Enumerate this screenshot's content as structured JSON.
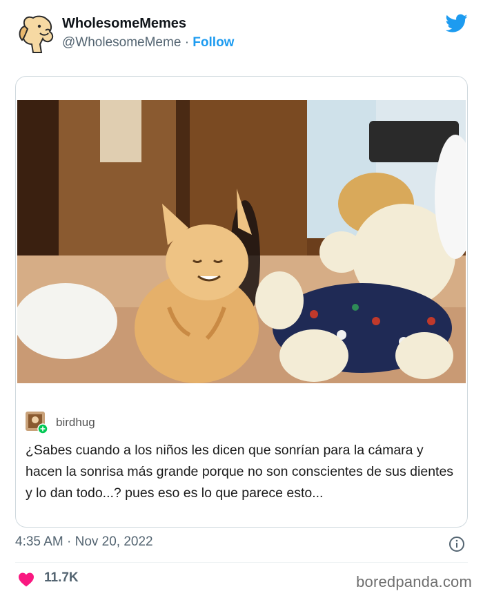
{
  "account": {
    "name": "WholesomeMemes",
    "handle": "@WholesomeMeme",
    "separator": "·",
    "follow_label": "Follow"
  },
  "embedded_post": {
    "author": "birdhug",
    "text": "¿Sabes cuando a los niños les dicen que sonrían para la cámara y hacen la sonrisa más grande porque no son conscientes de sus dientes y lo dan todo...? pues eso es lo que parece esto..."
  },
  "footer": {
    "timestamp": "4:35 AM · Nov 20, 2022",
    "likes": "11.7K"
  },
  "watermark": "boredpanda.com",
  "icons": {
    "brand": "twitter-bird-icon",
    "info": "info-icon",
    "like": "heart-icon",
    "avatar": "dog-avatar"
  },
  "colors": {
    "link": "#1d9bf0",
    "heart": "#f91880",
    "muted": "#536471",
    "border": "#cfd9de"
  }
}
